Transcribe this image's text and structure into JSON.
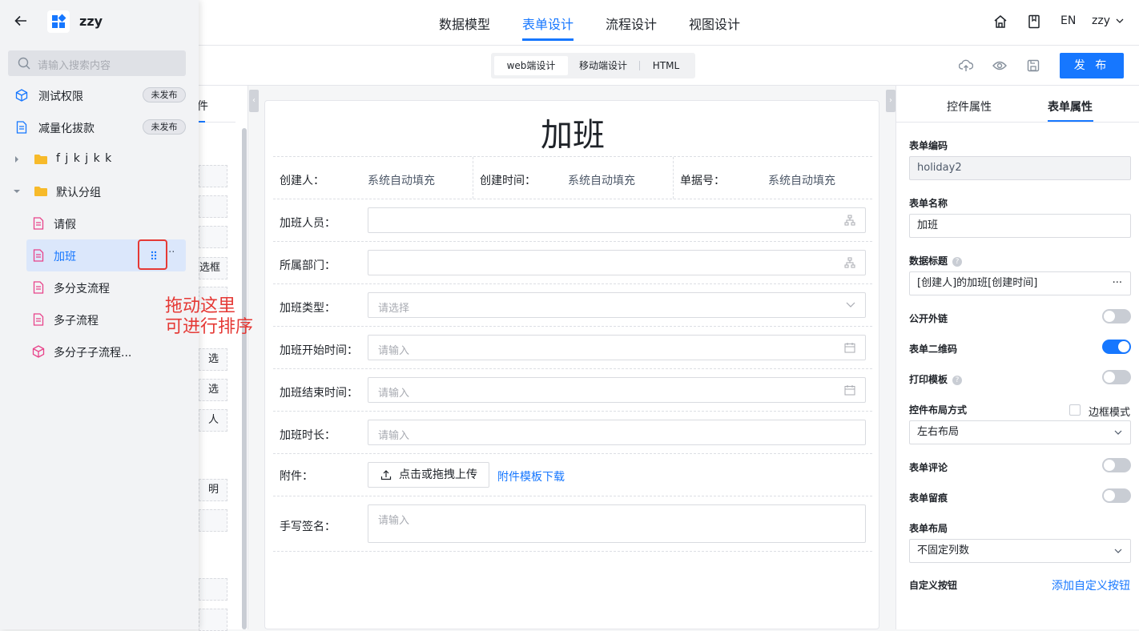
{
  "nav": {
    "tabs": [
      "数据模型",
      "表单设计",
      "流程设计",
      "视图设计"
    ],
    "active": "表单设计",
    "lang": "EN",
    "user": "zzy"
  },
  "toolbar": {
    "modes": [
      "web端设计",
      "移动端设计",
      "HTML"
    ],
    "active_mode": "web端设计",
    "publish": "发 布"
  },
  "sidebar": {
    "app_name": "zzy",
    "search_placeholder": "请输入搜索内容",
    "items": [
      {
        "label": "测试权限",
        "badge": "未发布",
        "icon": "cube-icon"
      },
      {
        "label": "减量化拔款",
        "badge": "未发布",
        "icon": "document-icon"
      },
      {
        "label": "f j k j k k",
        "icon": "folder-icon"
      },
      {
        "label": "默认分组",
        "icon": "folder-icon"
      },
      {
        "label": "请假",
        "icon": "form-icon"
      },
      {
        "label": "加班",
        "icon": "form-icon"
      },
      {
        "label": "多分支流程",
        "icon": "form-icon"
      },
      {
        "label": "多子流程",
        "icon": "form-icon"
      },
      {
        "label": "多分子子流程...",
        "icon": "cube-icon"
      }
    ],
    "more": "···",
    "annotation": "拖动这里\n可进行排序"
  },
  "left_panel": {
    "tab_fragment": "件",
    "ghost_items": [
      "选框",
      "选",
      "选",
      "人",
      "明"
    ]
  },
  "form": {
    "title": "加班",
    "meta": [
      {
        "label": "创建人：",
        "value": "系统自动填充"
      },
      {
        "label": "创建时间：",
        "value": "系统自动填充"
      },
      {
        "label": "单据号：",
        "value": "系统自动填充"
      }
    ],
    "fields": {
      "overtime_staff": {
        "label": "加班人员："
      },
      "department": {
        "label": "所属部门："
      },
      "overtime_type": {
        "label": "加班类型：",
        "placeholder": "请选择"
      },
      "start_time": {
        "label": "加班开始时间：",
        "placeholder": "请输入"
      },
      "end_time": {
        "label": "加班结束时间：",
        "placeholder": "请输入"
      },
      "duration": {
        "label": "加班时长：",
        "placeholder": "请输入"
      },
      "attachment": {
        "label": "附件：",
        "upload": "点击或拖拽上传",
        "template_link": "附件模板下载"
      },
      "signature": {
        "label": "手写签名：",
        "placeholder": "请输入"
      }
    }
  },
  "properties": {
    "tabs": [
      "控件属性",
      "表单属性"
    ],
    "active_tab": "表单属性",
    "form_code_label": "表单编码",
    "form_code": "holiday2",
    "form_name_label": "表单名称",
    "form_name": "加班",
    "data_title_label": "数据标题",
    "data_title": "[创建人]的加班[创建时间]",
    "data_title_more": "···",
    "public_link_label": "公开外链",
    "public_link": false,
    "qrcode_label": "表单二维码",
    "qrcode": true,
    "print_label": "打印模板",
    "print": false,
    "layout_label": "控件布局方式",
    "border_mode_label": "边框模式",
    "layout": "左右布局",
    "comment_label": "表单评论",
    "comment": false,
    "trace_label": "表单留痕",
    "trace": false,
    "form_layout_label": "表单布局",
    "form_layout": "不固定列数",
    "custom_button_label": "自定义按钮",
    "add_custom_button": "添加自定义按钮"
  }
}
